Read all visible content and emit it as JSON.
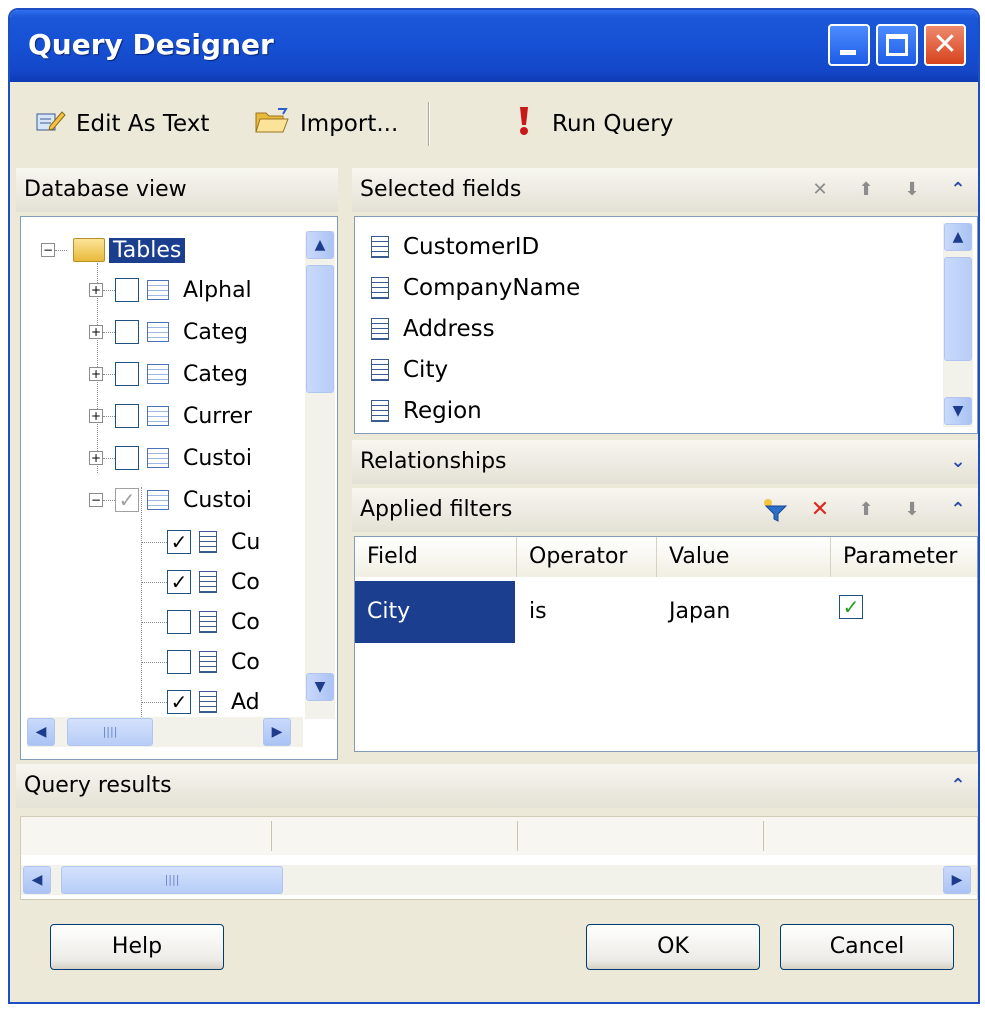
{
  "window": {
    "title": "Query Designer"
  },
  "toolbar": {
    "edit_as_text": "Edit As Text",
    "import": "Import...",
    "run_query": "Run Query"
  },
  "database_view": {
    "title": "Database view",
    "root": "Tables",
    "tables": [
      {
        "label": "Alphal",
        "checked": false,
        "expanded": false
      },
      {
        "label": "Categ",
        "checked": false,
        "expanded": false
      },
      {
        "label": "Categ",
        "checked": false,
        "expanded": false
      },
      {
        "label": "Currer",
        "checked": false,
        "expanded": false
      },
      {
        "label": "Custoi",
        "checked": false,
        "expanded": false
      },
      {
        "label": "Custoi",
        "checked": "partial",
        "expanded": true
      }
    ],
    "fields": [
      {
        "label": "Cu",
        "checked": true
      },
      {
        "label": "Co",
        "checked": true
      },
      {
        "label": "Co",
        "checked": false
      },
      {
        "label": "Co",
        "checked": false
      },
      {
        "label": "Ad",
        "checked": true
      }
    ]
  },
  "selected_fields": {
    "title": "Selected fields",
    "items": [
      "CustomerID",
      "CompanyName",
      "Address",
      "City",
      "Region"
    ]
  },
  "relationships": {
    "title": "Relationships"
  },
  "applied_filters": {
    "title": "Applied filters",
    "columns": [
      "Field",
      "Operator",
      "Value",
      "Parameter"
    ],
    "rows": [
      {
        "field": "City",
        "operator": "is",
        "value": "Japan",
        "parameter": true
      }
    ]
  },
  "query_results": {
    "title": "Query results"
  },
  "buttons": {
    "help": "Help",
    "ok": "OK",
    "cancel": "Cancel"
  },
  "colors": {
    "title_bar": "#1650d4",
    "selection": "#1b3e8f",
    "panel_bg": "#ece9d8"
  }
}
